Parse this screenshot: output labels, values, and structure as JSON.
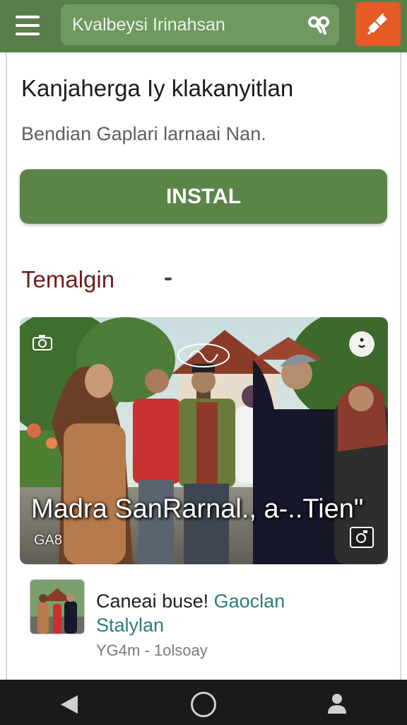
{
  "header": {
    "search_text": "Kvalbeysi Irinahsan",
    "menu_icon": "hamburger-menu-icon",
    "search_icon": "search-icon",
    "action_icon": "pen-icon",
    "colors": {
      "bar": "#587f4a",
      "search_bg": "#6f9960",
      "action": "#e55a26"
    }
  },
  "app": {
    "title": "Kanjahergа Iy klakanyitlan",
    "subtitle": "Bendian Gaplari larnaai Nan.",
    "install_label": "INSTAL"
  },
  "section": {
    "title": "Temalgin",
    "marker": "-"
  },
  "media": {
    "caption": "Madra SanRarnal., a-..Tien\"",
    "meta": "GA8",
    "top_left_icon": "camera-icon",
    "center_icon": "logo-badge-icon",
    "top_right_icon": "more-icon",
    "bottom_right_icon": "camera-icon"
  },
  "list_item": {
    "title": "Caneai buse!",
    "title_accent": "Gaoclan",
    "subtitle": "Stalylan",
    "meta": "YG4m - 1olsoay"
  },
  "navbar": {
    "back_icon": "back-triangle-icon",
    "home_icon": "home-circle-icon",
    "user_icon": "person-icon"
  }
}
